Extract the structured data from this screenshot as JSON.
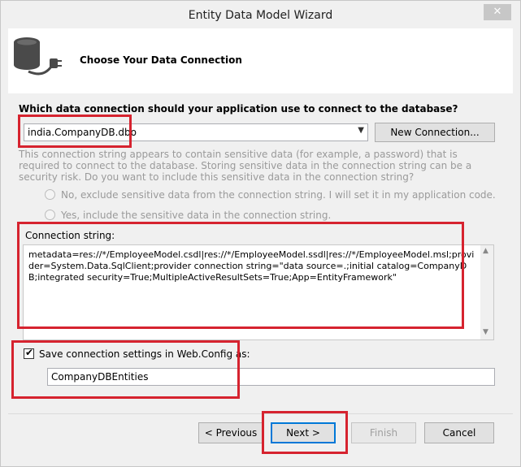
{
  "window": {
    "title": "Entity Data Model Wizard",
    "close_glyph": "✕"
  },
  "header": {
    "title": "Choose Your Data Connection",
    "icon": "database-plug-icon"
  },
  "connection": {
    "question": "Which data connection should your application use to connect to the database?",
    "selected": "india.CompanyDB.dbo",
    "new_connection_label": "New Connection..."
  },
  "sensitive": {
    "text": "This connection string appears to contain sensitive data (for example, a password) that is required to connect to the database. Storing sensitive data in the connection string can be a security risk. Do you want to include this sensitive data in the connection string?",
    "option_no": "No, exclude sensitive data from the connection string. I will set it in my application code.",
    "option_yes": "Yes, include the sensitive data in the connection string."
  },
  "connection_string": {
    "label": "Connection string:",
    "value": "metadata=res://*/EmployeeModel.csdl|res://*/EmployeeModel.ssdl|res://*/EmployeeModel.msl;provider=System.Data.SqlClient;provider connection string=\"data source=.;initial catalog=CompanyDB;integrated security=True;MultipleActiveResultSets=True;App=EntityFramework\""
  },
  "save": {
    "label": "Save connection settings in Web.Config as:",
    "checked": true,
    "value": "CompanyDBEntities"
  },
  "buttons": {
    "previous": "< Previous",
    "next": "Next >",
    "finish": "Finish",
    "cancel": "Cancel"
  },
  "colors": {
    "annotation": "#d6232f",
    "accent": "#0078d7"
  }
}
